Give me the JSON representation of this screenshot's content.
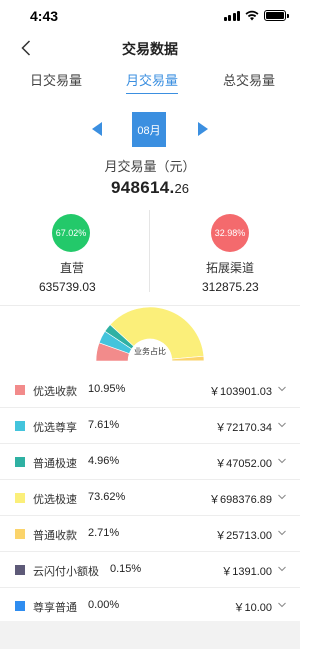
{
  "status": {
    "time": "4:43"
  },
  "nav": {
    "title": "交易数据"
  },
  "tabs": [
    {
      "label": "日交易量"
    },
    {
      "label": "月交易量"
    },
    {
      "label": "总交易量"
    }
  ],
  "month": {
    "label": "08月"
  },
  "total": {
    "label": "月交易量（元）",
    "integer": "948614.",
    "decimal": "26"
  },
  "split": [
    {
      "pct": "67.02%",
      "label": "直营",
      "amount": "635739.03",
      "color": "#23c96a"
    },
    {
      "pct": "32.98%",
      "label": "拓展渠道",
      "amount": "312875.23",
      "color": "#f46a6d"
    }
  ],
  "pie": {
    "caption": "业务占比"
  },
  "items": [
    {
      "name": "优选收款",
      "pct": "10.95%",
      "amount": "￥103901.03",
      "color": "#f28b8b",
      "share": 10.95
    },
    {
      "name": "优选尊享",
      "pct": "7.61%",
      "amount": "￥72170.34",
      "color": "#43c4dc",
      "share": 7.61
    },
    {
      "name": "普通极速",
      "pct": "4.96%",
      "amount": "￥47052.00",
      "color": "#2fb1a3",
      "share": 4.96
    },
    {
      "name": "优选极速",
      "pct": "73.62%",
      "amount": "￥698376.89",
      "color": "#fbef7a",
      "share": 73.62
    },
    {
      "name": "普通收款",
      "pct": "2.71%",
      "amount": "￥25713.00",
      "color": "#fbd46b",
      "share": 2.71
    },
    {
      "name": "云闪付小额极",
      "pct": "0.15%",
      "amount": "￥1391.00",
      "color": "#5e5a78",
      "share": 0.15
    },
    {
      "name": "尊享普通",
      "pct": "0.00%",
      "amount": "￥10.00",
      "color": "#2f8df0",
      "share": 0.0
    }
  ]
}
